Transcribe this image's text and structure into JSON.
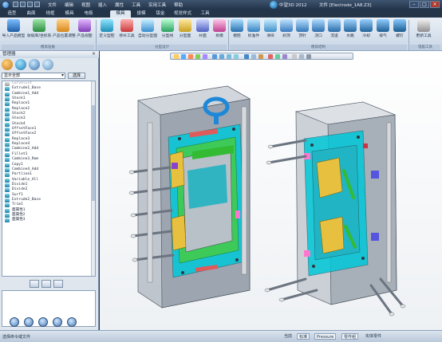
{
  "app": {
    "title": "文件 [Electrode_1A8.Z3]",
    "brand": "中望3D 2012",
    "colors": {
      "accent": "#2a6fb5",
      "mold_blue": "#00c8d8",
      "mold_green": "#44cc44",
      "mold_yellow": "#e8c040",
      "mold_gray": "#9aa3ad",
      "viewport_bg": "#ffffff"
    }
  },
  "menubar": [
    "文件",
    "编辑",
    "视图",
    "插入",
    "属性",
    "工具",
    "实用工具",
    "帮助"
  ],
  "ribbon": {
    "tabs": [
      "造型",
      "曲面",
      "线框",
      "模具",
      "电极",
      "拔模",
      "钣金",
      "视觉样式",
      "工具",
      "显示",
      "插件",
      "视觉效果",
      "嵌件"
    ],
    "active_tab": "模具",
    "buttons_left": [
      "导入产品模型",
      "收缩率/坐标系",
      "产品位置调整",
      "产品视图",
      "定义型腔",
      "修补工具",
      "自动分型面",
      "分型线",
      "分型面",
      "补面",
      "拆模",
      "分模"
    ],
    "buttons_right": [
      "模胚",
      "标准件",
      "滑块",
      "斜顶",
      "顶针",
      "浇口",
      "流道",
      "水路",
      "冷却",
      "排气",
      "螺钉",
      "电极"
    ],
    "groups": [
      "模具准备",
      "分型设计",
      "模具结构",
      "电极工具"
    ],
    "extra": "更新工具"
  },
  "panel": {
    "title": "管理器",
    "close": "×",
    "display_value": "显示全部",
    "select_label": "选择",
    "tree_items": [
      "Curvelist",
      "Extrude1_Base",
      "Combine1_Add",
      "Stock1",
      "Replace1",
      "Replace2",
      "Stock2",
      "Stock3",
      "Stock4",
      "OffsetFace1",
      "OffsetFace2",
      "Replace3",
      "Replace4",
      "Combine2_Add",
      "Fillet1",
      "Combine3_Rem",
      "Copy1",
      "Combine4_Add",
      "Partline1",
      "Variable_All",
      "Divide1",
      "Divide2",
      "Surf1",
      "Extrude2_Base",
      "Trim1",
      "面属性1",
      "面属性2",
      "面属性3"
    ]
  },
  "statusbar": {
    "message": "选择命令或文件",
    "items": [
      "当前",
      "标准",
      "Pressure",
      "零件组",
      "实体零件"
    ]
  }
}
